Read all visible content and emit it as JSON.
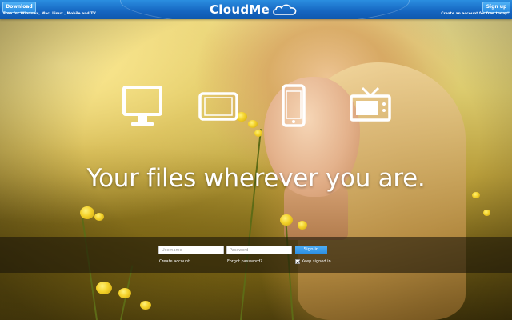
{
  "header": {
    "download_label": "Download",
    "download_tagline": "Free for Windows, Mac, Linux , Mobile and TV",
    "logo_text": "CloudMe",
    "signup_label": "Sign up",
    "signup_tagline": "Create an account for free today!",
    "brand_color": "#1565c0"
  },
  "hero": {
    "devices": [
      "desktop-monitor-icon",
      "tablet-landscape-icon",
      "smartphone-icon",
      "tv-icon"
    ],
    "headline": "Your files wherever you are."
  },
  "login": {
    "username_placeholder": "Username",
    "password_placeholder": "Password",
    "signin_label": "Sign in",
    "create_account_label": "Create account",
    "forgot_password_label": "Forgot password?",
    "keep_signed_in_label": "Keep signed in",
    "keep_signed_in_checked": true
  }
}
